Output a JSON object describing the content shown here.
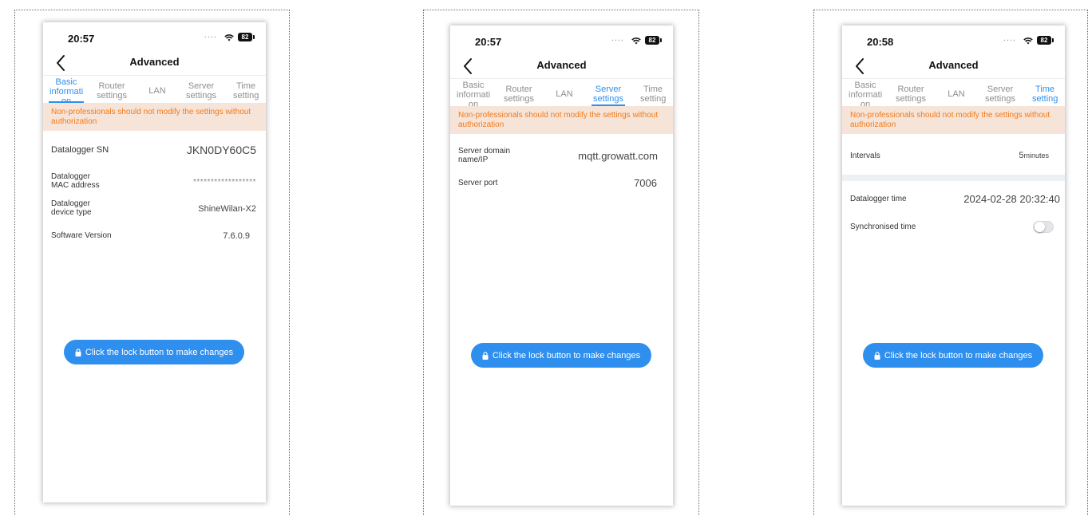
{
  "screens": [
    {
      "status_time": "20:57",
      "battery": "82",
      "nav_title": "Advanced",
      "tabs": [
        {
          "label": "Basic informati on",
          "active": true
        },
        {
          "label": "Router settings",
          "active": false
        },
        {
          "label": "LAN",
          "active": false
        },
        {
          "label": "Server settings",
          "active": false
        },
        {
          "label": "Time setting",
          "active": false
        }
      ],
      "warning": "Non-professionals should not modify the settings without authorization",
      "rows": [
        {
          "label": "Datalogger SN",
          "value": "JKN0DY60C5"
        },
        {
          "label": "Datalogger MAC address",
          "value": "******************"
        },
        {
          "label": "Datalogger device type",
          "value": "ShineWilan-X2"
        },
        {
          "label": "Software Version",
          "value": "7.6.0.9"
        }
      ],
      "lock_button": "Click the lock button to make changes"
    },
    {
      "status_time": "20:57",
      "battery": "82",
      "nav_title": "Advanced",
      "tabs": [
        {
          "label": "Basic informati on",
          "active": false
        },
        {
          "label": "Router settings",
          "active": false
        },
        {
          "label": "LAN",
          "active": false
        },
        {
          "label": "Server settings",
          "active": true
        },
        {
          "label": "Time setting",
          "active": false
        }
      ],
      "warning": "Non-professionals should not modify the settings without authorization",
      "rows": [
        {
          "label": "Server domain name/IP",
          "value": "mqtt.growatt.com"
        },
        {
          "label": "Server port",
          "value": "7006"
        }
      ],
      "lock_button": "Click the lock button to make changes"
    },
    {
      "status_time": "20:58",
      "battery": "82",
      "nav_title": "Advanced",
      "tabs": [
        {
          "label": "Basic informati on",
          "active": false
        },
        {
          "label": "Router settings",
          "active": false
        },
        {
          "label": "LAN",
          "active": false
        },
        {
          "label": "Server settings",
          "active": false
        },
        {
          "label": "Time setting",
          "active": true
        }
      ],
      "warning": "Non-professionals should not modify the settings without authorization",
      "intervals": {
        "label": "Intervals",
        "value": "5",
        "unit": "minutes"
      },
      "rows": [
        {
          "label": "Datalogger time",
          "value": "2024-02-28 20:32:40"
        }
      ],
      "sync": {
        "label": "Synchronised time",
        "on": false
      },
      "lock_button": "Click the lock button to make changes"
    }
  ],
  "colors": {
    "accent": "#2f8fef",
    "warning_bg": "#f7e4d8",
    "warning_text": "#f07a1a",
    "inactive_tab": "#8e8e8e"
  },
  "icons": [
    "wifi-icon",
    "battery-icon",
    "back-chevron-icon",
    "lock-icon"
  ]
}
